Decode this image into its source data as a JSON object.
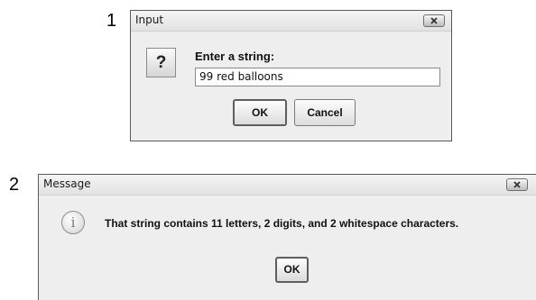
{
  "step_labels": [
    "1",
    "2"
  ],
  "input_dialog": {
    "title": "Input",
    "icon": "question-icon",
    "icon_glyph": "?",
    "prompt": "Enter a string:",
    "input_value": "99 red balloons",
    "ok_label": "OK",
    "cancel_label": "Cancel"
  },
  "message_dialog": {
    "title": "Message",
    "icon": "info-icon",
    "icon_glyph": "i",
    "message": "That string contains 11 letters, 2 digits, and 2 whitespace characters.",
    "ok_label": "OK"
  }
}
